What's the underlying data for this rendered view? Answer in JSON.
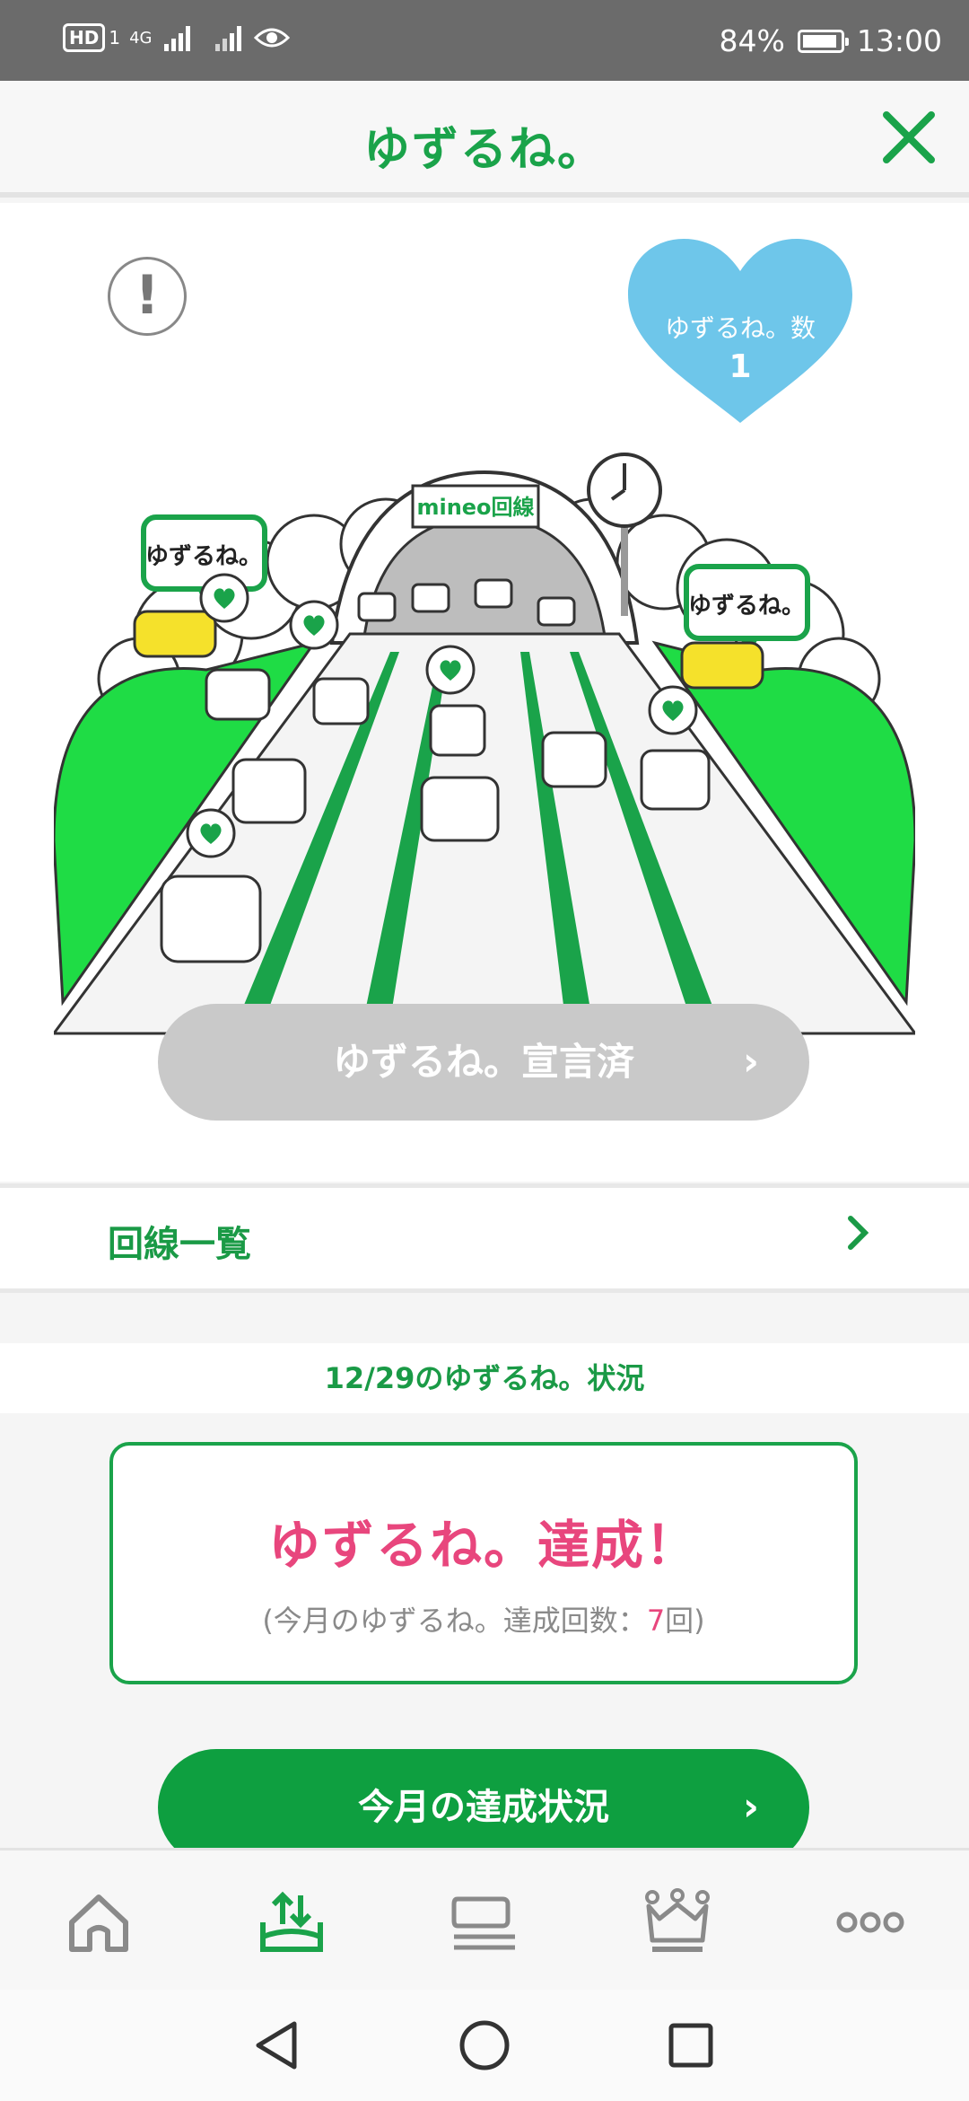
{
  "status_bar": {
    "network_badge": "HD",
    "network_sub": "1",
    "network_type": "4G",
    "battery": "84%",
    "time": "13:00"
  },
  "header": {
    "title": "ゆずるね。",
    "close_icon": "close-icon"
  },
  "hero": {
    "info_icon": "exclamation-icon",
    "heart_label": "ゆずるね。数",
    "heart_value": "1",
    "illustration": {
      "sign_text": "mineo回線",
      "bubble_text": "ゆずるね。"
    },
    "declare_button": "ゆずるね。宣言済",
    "declare_chevron": "›"
  },
  "line_list": {
    "label": "回線一覧"
  },
  "status": {
    "heading": "12/29のゆずるね。状況",
    "result_title": "ゆずるね。達成！",
    "result_prefix": "(今月のゆずるね。達成回数：",
    "result_count": "7",
    "result_suffix": "回)"
  },
  "month_button": {
    "label": "今月の達成状況",
    "chevron": "›"
  },
  "bottom_nav": {
    "items": [
      {
        "icon": "home-icon"
      },
      {
        "icon": "yuzurune-icon",
        "active": true
      },
      {
        "icon": "chat-icon"
      },
      {
        "icon": "crown-icon"
      },
      {
        "icon": "more-icon"
      }
    ]
  },
  "colors": {
    "brand_green": "#1aa34a",
    "accent_pink": "#e8467d",
    "heart_blue": "#6ec6ea"
  }
}
